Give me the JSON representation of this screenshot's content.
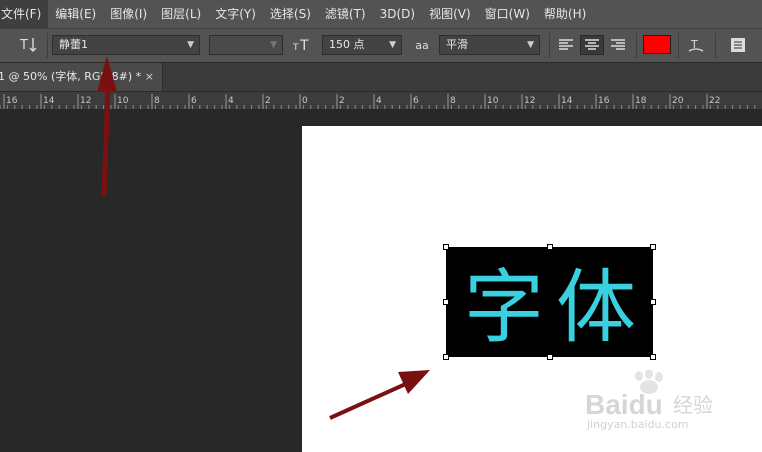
{
  "menubar": {
    "items": [
      "文件(F)",
      "编辑(E)",
      "图像(I)",
      "图层(L)",
      "文字(Y)",
      "选择(S)",
      "滤镜(T)",
      "3D(D)",
      "视图(V)",
      "窗口(W)",
      "帮助(H)"
    ]
  },
  "options": {
    "font_family": "静蕾1",
    "font_size": "150 点",
    "antialias_label": "aa",
    "antialias": "平滑",
    "text_color": "#ff0000"
  },
  "document": {
    "tab_title": "1 @ 50% (字体, RGB/8#) *",
    "close_glyph": "×",
    "text_chars": [
      "字",
      "体"
    ],
    "text_fill_color": "#3ad0e0"
  },
  "ruler": {
    "labels": [
      "16",
      "14",
      "12",
      "10",
      "8",
      "6",
      "4",
      "2",
      "0",
      "2",
      "4",
      "6",
      "8",
      "10",
      "12",
      "14",
      "16",
      "18",
      "20",
      "22"
    ]
  },
  "watermark": {
    "brand": "Baidu",
    "suffix": "经验",
    "url": "jingyan.baidu.com"
  }
}
